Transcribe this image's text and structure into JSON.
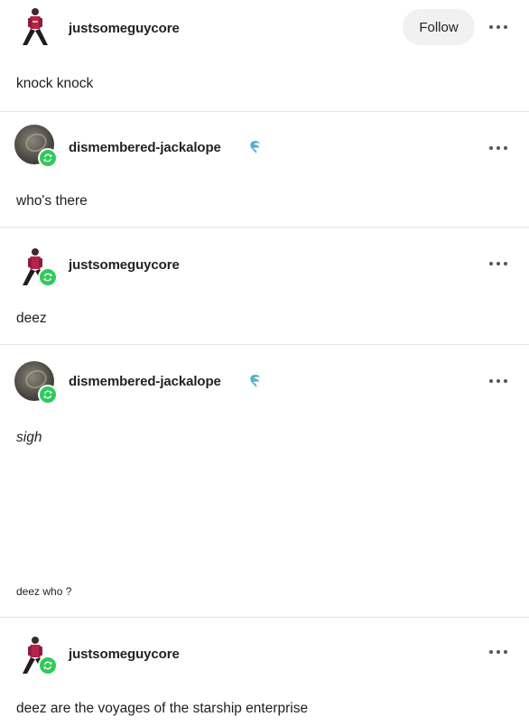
{
  "posts": [
    {
      "username": "justsomeguycore",
      "follow_label": "Follow",
      "text": "knock knock"
    },
    {
      "username": "dismembered-jackalope",
      "text": "who's there"
    },
    {
      "username": "justsomeguycore",
      "text": "deez"
    },
    {
      "username": "dismembered-jackalope",
      "text": "sigh",
      "subtext": "deez who ?"
    },
    {
      "username": "justsomeguycore",
      "text": "deez are the voyages of the starship enterprise"
    }
  ],
  "colors": {
    "reblog_badge": "#2ecb5a",
    "follow_button_bg": "#f1f1f1",
    "divider": "#e4e4e4",
    "blog_badge": "#4fb3c9"
  },
  "icons": {
    "more": "more-options-icon",
    "reblog": "reblog-icon",
    "blog_badge": "tumblr-badge-icon"
  }
}
